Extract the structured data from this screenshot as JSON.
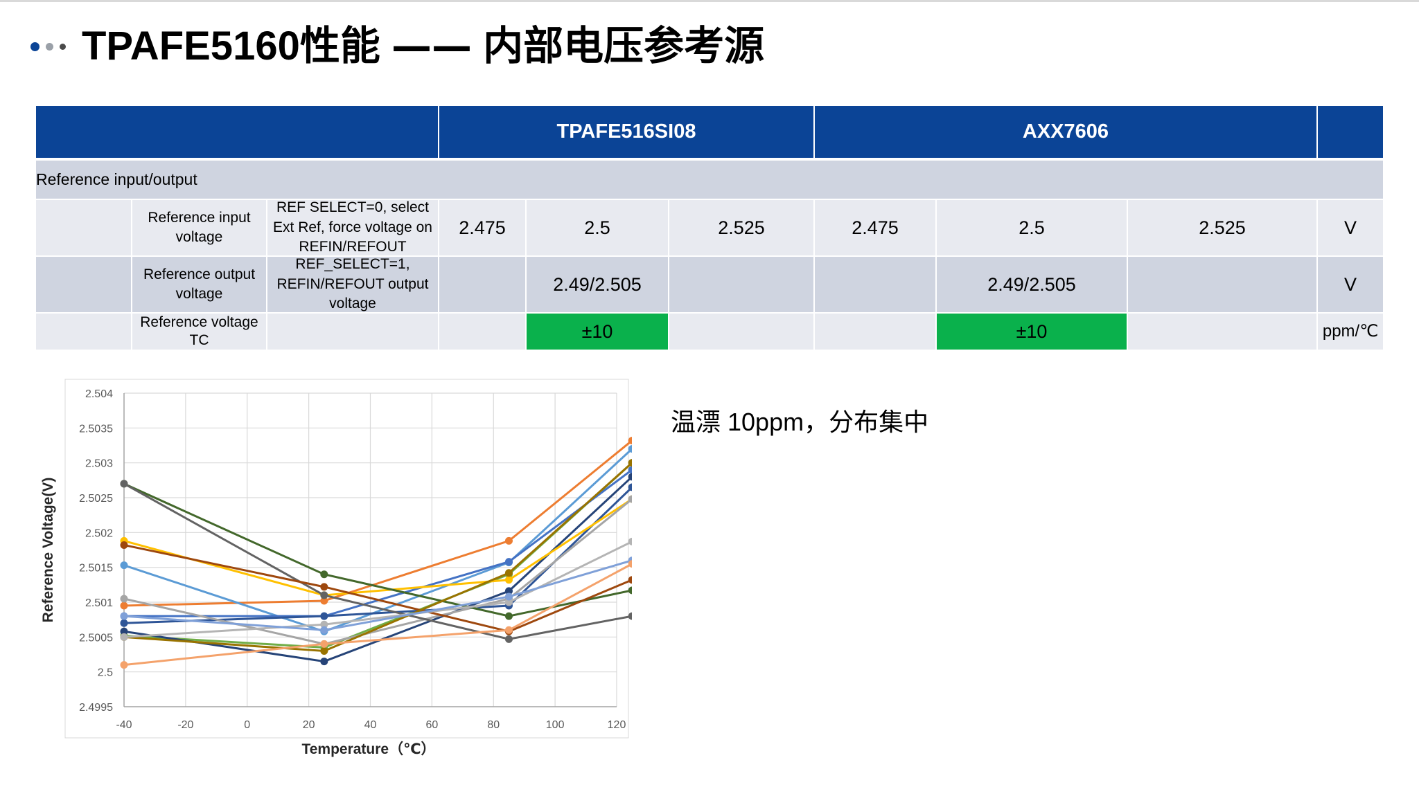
{
  "slide": {
    "title_main": "TPAFE5160性能 ",
    "title_dash": "——",
    "title_sub": " 内部电压参考源",
    "note": "温漂 10ppm，分布集中"
  },
  "colors": {
    "header_blue": "#0b4496",
    "highlight_green": "#0ab14c",
    "dot_dark": "#0b4496",
    "dot_mid": "#9aa0a8",
    "dot_light": "#4a4a4a"
  },
  "table": {
    "header": {
      "col_a": "TPAFE516SI08",
      "col_b": "AXX7606"
    },
    "section_label": "Reference input/output",
    "rows": [
      {
        "param": "Reference input voltage",
        "condition": "REF SELECT=0, select Ext Ref, force voltage on REFIN/REFOUT",
        "a_min": "2.475",
        "a_typ": "2.5",
        "a_max": "2.525",
        "b_min": "2.475",
        "b_typ": "2.5",
        "b_max": "2.525",
        "unit": "V"
      },
      {
        "param": "Reference output voltage",
        "condition": "REF_SELECT=1, REFIN/REFOUT output voltage",
        "a_min": "",
        "a_typ": "2.49/2.505",
        "a_max": "",
        "b_min": "",
        "b_typ": "2.49/2.505",
        "b_max": "",
        "unit": "V"
      },
      {
        "param": "Reference voltage TC",
        "condition": "",
        "a_min": "",
        "a_typ": "±10",
        "a_max": "",
        "b_min": "",
        "b_typ": "±10",
        "b_max": "",
        "unit": "ppm/℃"
      }
    ]
  },
  "chart_data": {
    "type": "line",
    "title": "",
    "xlabel": "Temperature（℃）",
    "ylabel": "Reference Voltage(V)",
    "xlim": [
      -40,
      120
    ],
    "ylim": [
      2.4995,
      2.504
    ],
    "x_ticks": [
      "-40",
      "-20",
      "0",
      "20",
      "40",
      "60",
      "80",
      "100",
      "120"
    ],
    "y_ticks": [
      "2.4995",
      "2.5",
      "2.5005",
      "2.501",
      "2.5015",
      "2.502",
      "2.5025",
      "2.503",
      "2.5035",
      "2.504"
    ],
    "grid": true,
    "legend": "none",
    "x": [
      -40,
      25,
      85,
      125
    ],
    "series": [
      {
        "color": "#ed7d31",
        "values": [
          2.50095,
          2.50102,
          2.50188,
          2.50332
        ]
      },
      {
        "color": "#5b9bd5",
        "values": [
          2.50153,
          2.50058,
          2.50157,
          2.5032
        ]
      },
      {
        "color": "#70ad47",
        "values": [
          2.50052,
          2.50035,
          2.5014,
          2.503
        ]
      },
      {
        "color": "#4472c4",
        "values": [
          2.5008,
          2.5008,
          2.50158,
          2.5029
        ]
      },
      {
        "color": "#264478",
        "values": [
          2.50058,
          2.50015,
          2.50116,
          2.5028
        ]
      },
      {
        "color": "#2e5597",
        "values": [
          2.5007,
          2.5008,
          2.50095,
          2.50265
        ]
      },
      {
        "color": "#ffc000",
        "values": [
          2.50188,
          2.5011,
          2.50132,
          2.50248
        ]
      },
      {
        "color": "#a5a5a5",
        "values": [
          2.50105,
          2.5004,
          2.50105,
          2.50248
        ]
      },
      {
        "color": "#43682b",
        "values": [
          2.5027,
          2.5014,
          2.5008,
          2.50117
        ]
      },
      {
        "color": "#636363",
        "values": [
          2.5027,
          2.5011,
          2.50047,
          2.5008
        ]
      },
      {
        "color": "#9e480e",
        "values": [
          2.50182,
          2.50122,
          2.50058,
          2.50132
        ]
      },
      {
        "color": "#997300",
        "values": [
          2.5005,
          2.5003,
          2.50142,
          2.503
        ]
      },
      {
        "color": "#b4b4b4",
        "values": [
          2.5005,
          2.50068,
          2.501,
          2.50187
        ]
      },
      {
        "color": "#7fa0d8",
        "values": [
          2.5008,
          2.5006,
          2.50108,
          2.5016
        ]
      },
      {
        "color": "#f4a26b",
        "values": [
          2.5001,
          2.5004,
          2.5006,
          2.50155
        ]
      }
    ]
  }
}
